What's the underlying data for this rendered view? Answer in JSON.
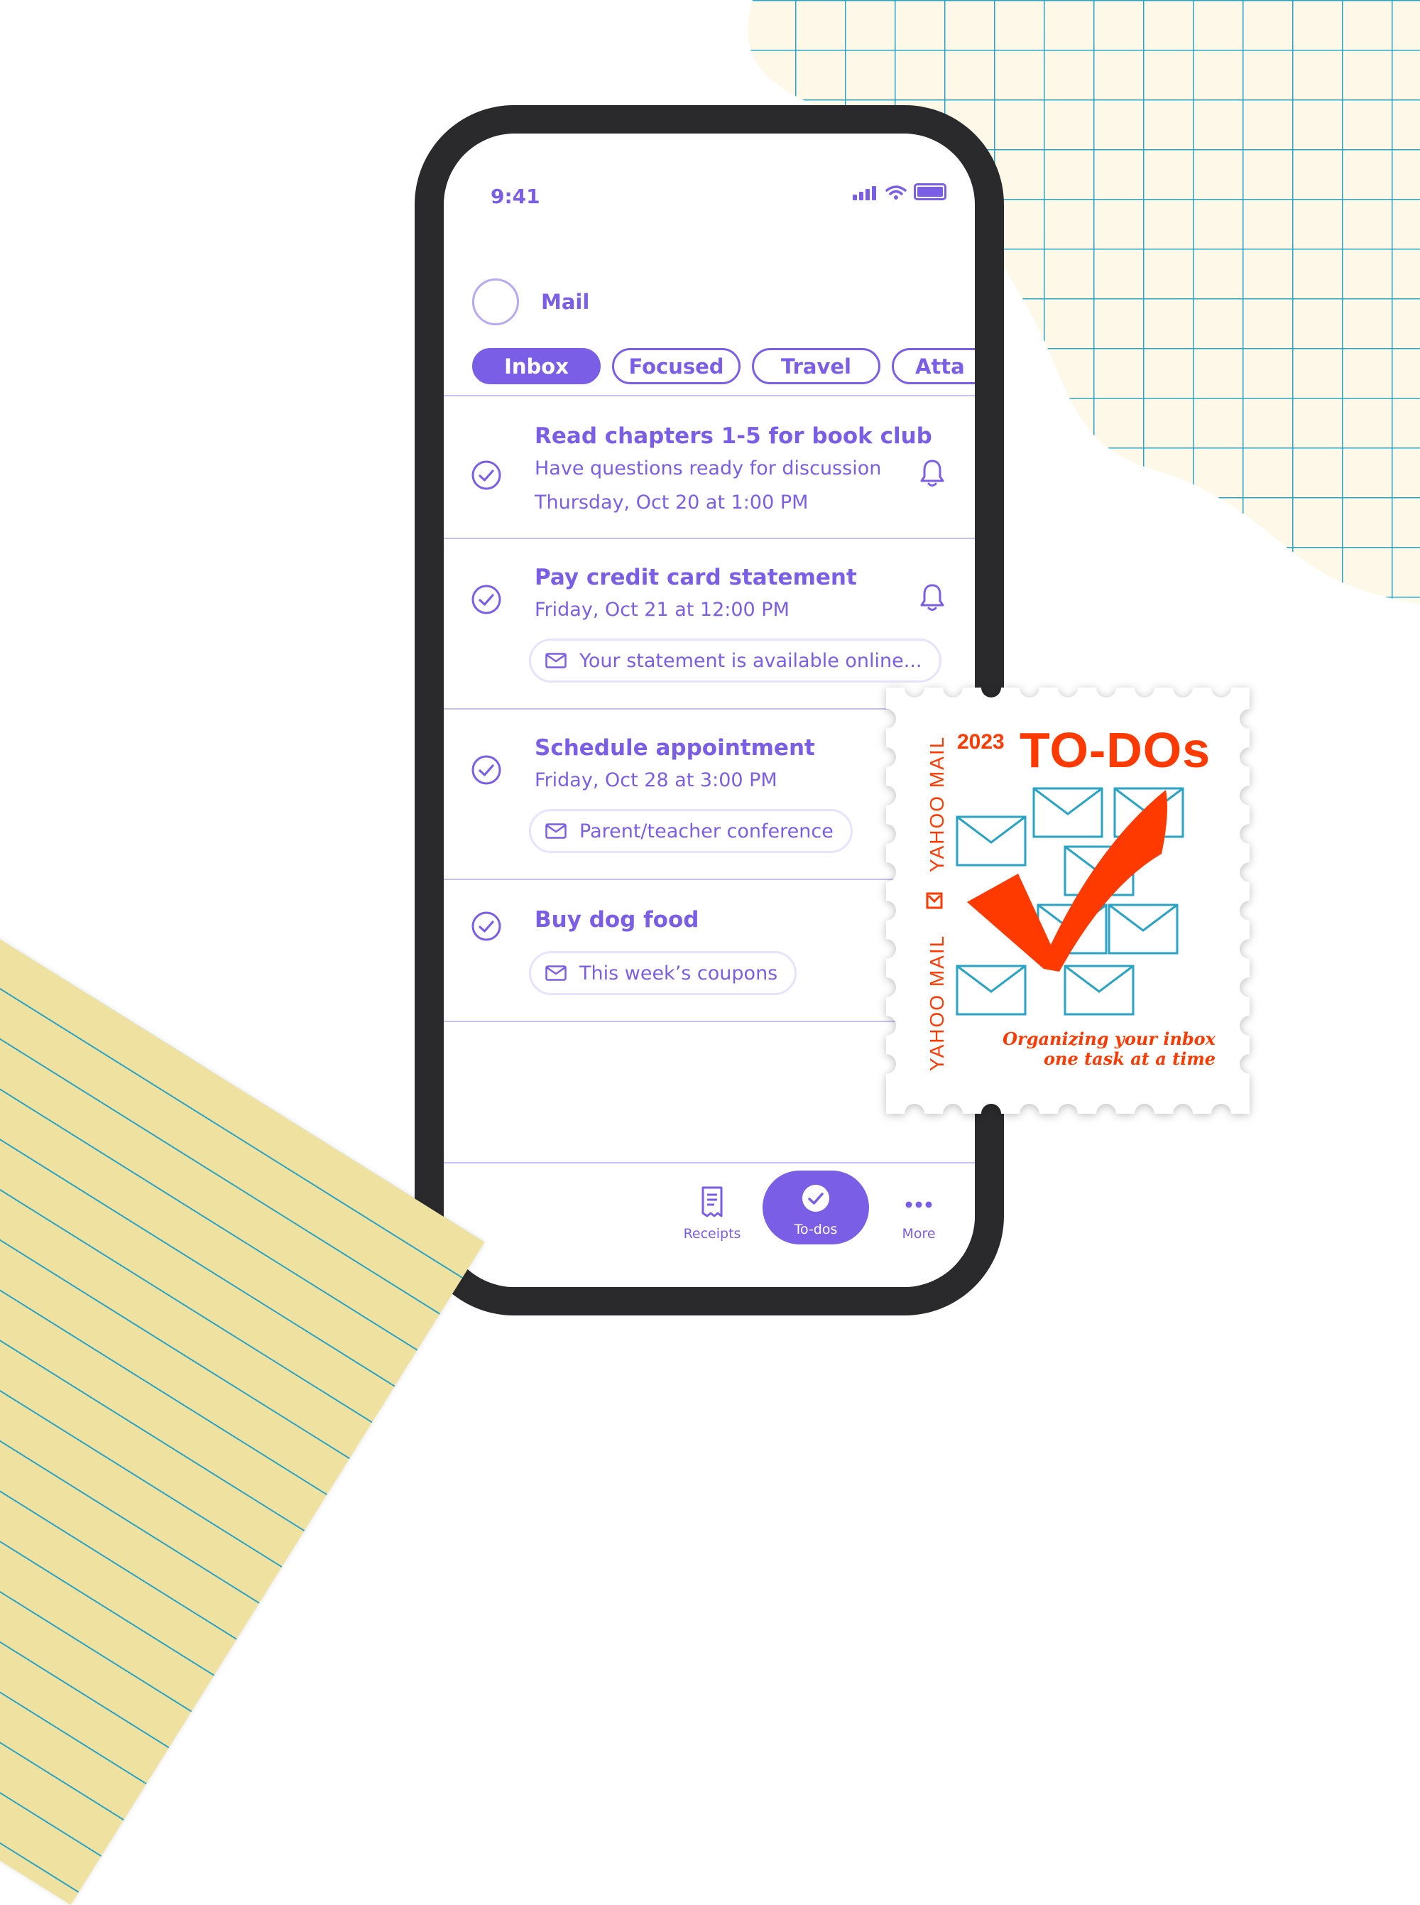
{
  "status_bar": {
    "time": "9:41"
  },
  "header": {
    "title": "Mail",
    "tabs": [
      {
        "label": "Inbox",
        "active": true
      },
      {
        "label": "Focused",
        "active": false
      },
      {
        "label": "Travel",
        "active": false
      },
      {
        "label": "Atta",
        "active": false
      }
    ]
  },
  "todos": [
    {
      "title": "Read chapters 1-5 for book club",
      "subtitle": "Have questions ready for discussion",
      "due": "Thursday, Oct 20 at 1:00 PM",
      "has_reminder": true
    },
    {
      "title": "Pay credit card statement",
      "due": "Friday, Oct 21 at 12:00 PM",
      "email_chip": "Your statement is available online...",
      "has_reminder": true
    },
    {
      "title": "Schedule appointment",
      "due": "Friday, Oct 28 at 3:00 PM",
      "email_chip": "Parent/teacher conference",
      "has_reminder": false
    },
    {
      "title": "Buy dog food",
      "email_chip": "This week’s coupons",
      "has_reminder": false
    }
  ],
  "bottom_nav": [
    {
      "label": "Receipts",
      "icon": "receipt-icon"
    },
    {
      "label": "To-dos",
      "icon": "check-circle-icon",
      "active": true
    },
    {
      "label": "More",
      "icon": "more-dots-icon"
    }
  ],
  "stamp": {
    "year": "2023",
    "title": "TO-DOs",
    "side_text_top": "YAHOO MAIL",
    "side_text_bottom": "YAHOO MAIL",
    "tagline_line1": "Organizing your inbox",
    "tagline_line2": "one task at a time"
  },
  "colors": {
    "accent": "#7b5ee6",
    "stamp_red": "#ff3a00",
    "grid_line": "#2aa3c4",
    "grid_bg": "#fdf8e7",
    "legal_pad": "#efe2a0"
  }
}
